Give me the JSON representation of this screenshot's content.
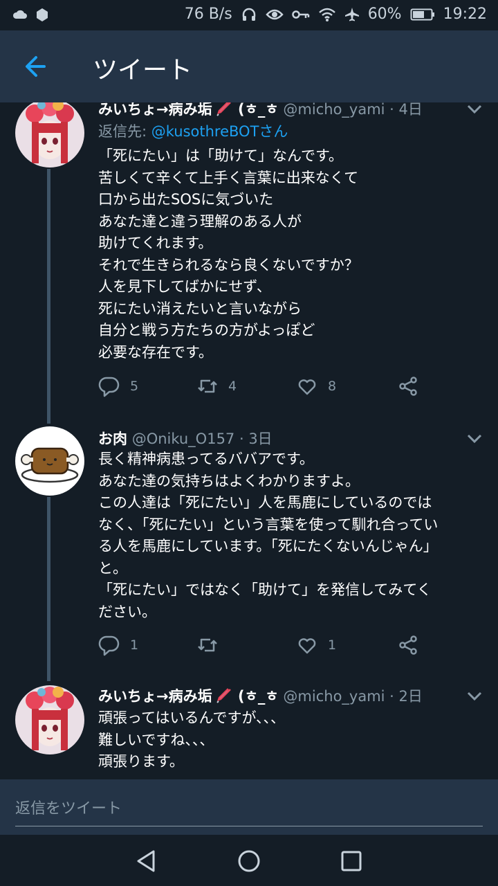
{
  "status_bar": {
    "net_speed": "76 B/s",
    "battery": "60%",
    "time": "19:22"
  },
  "app_bar": {
    "title": "ツイート"
  },
  "tweets": [
    {
      "name": "みいちょ→病み垢",
      "name_suffix": "(ㅎ_ㅎ",
      "handle": "@micho_yami · 4日",
      "reply_prefix": "返信先: ",
      "reply_to": "@kusothreBOTさん",
      "lines": [
        "「死にたい」は「助けて」なんです。",
        "苦しくて辛くて上手く言葉に出来なくて",
        "口から出たSOSに気づいた",
        "あなた達と違う理解のある人が",
        "助けてくれます。",
        "それで生きられるなら良くないですか？",
        "人を見下してばかにせず、",
        "死にたい消えたいと言いながら",
        "自分と戦う方たちの方がよっぽど",
        "必要な存在です。"
      ],
      "replies": "5",
      "retweets": "4",
      "likes": "8"
    },
    {
      "name": "お肉",
      "handle": "@Oniku_O157 · 3日",
      "lines": [
        "長く精神病患ってるババアです。",
        "あなた達の気持ちはよくわかりますよ。",
        "この人達は「死にたい」人を馬鹿にしているのでは",
        "なく、「死にたい」という言葉を使って馴れ合ってい",
        "る人を馬鹿にしています。「死にたくないんじゃん」",
        "と。",
        "「死にたい」ではなく「助けて」を発信してみてく",
        "ださい。"
      ],
      "replies": "1",
      "retweets": "",
      "likes": "1"
    },
    {
      "name": "みいちょ→病み垢",
      "name_suffix": "(ㅎ_ㅎ",
      "handle": "@micho_yami · 2日",
      "lines": [
        "頑張ってはいるんですが、、、",
        "難しいですね、、、",
        "頑張ります。"
      ]
    }
  ],
  "compose": {
    "placeholder": "返信をツイート"
  },
  "colors": {
    "background": "#141d26",
    "bar": "#243447",
    "accent": "#1da1f2",
    "muted": "#8899a6"
  }
}
